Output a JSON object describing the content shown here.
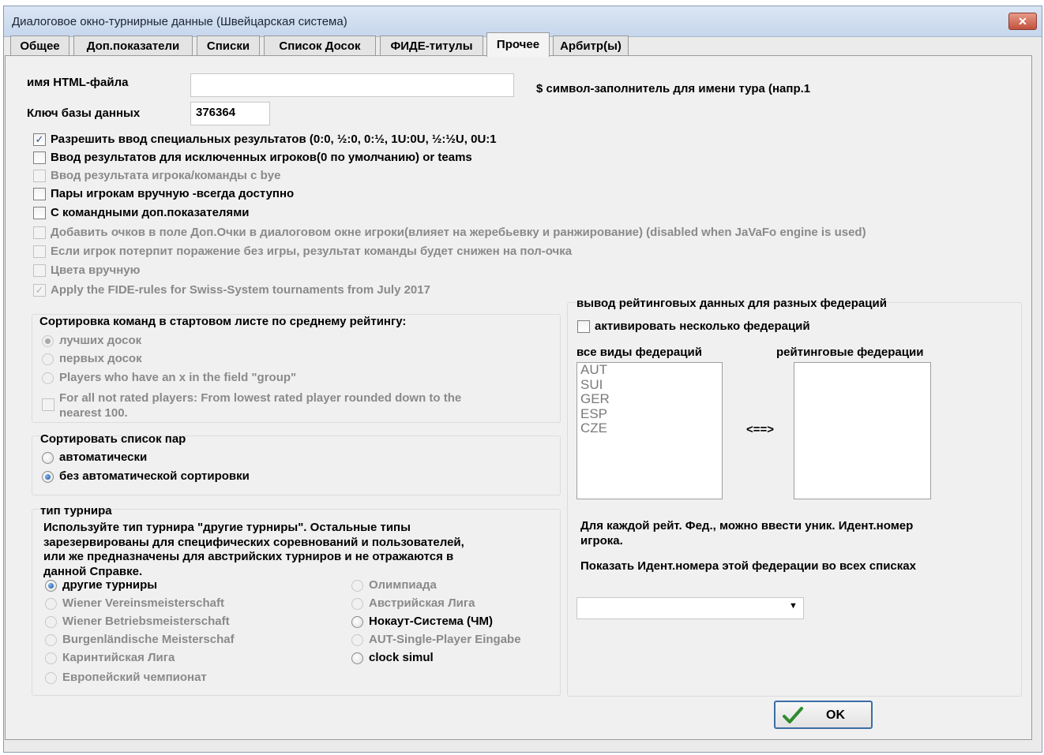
{
  "window": {
    "title": "Диалоговое окно-турнирные данные (Швейцарская система)",
    "close_glyph": "✕"
  },
  "tabs": [
    {
      "label": "Общее"
    },
    {
      "label": "Доп.показатели"
    },
    {
      "label": "Списки"
    },
    {
      "label": "Список Досок"
    },
    {
      "label": "ФИДЕ-титулы"
    },
    {
      "label": "Прочее",
      "active": true
    },
    {
      "label": "Арбитр(ы)"
    }
  ],
  "fields": {
    "html_file_label": "имя HTML-файла",
    "html_file_value": "",
    "html_file_hint": "$ символ-заполнитель для  имени тура (напр.1",
    "db_key_label": "Ключ базы данных",
    "db_key_value": "376364"
  },
  "options": [
    {
      "label": "Разрешить ввод специальных результатов (0:0, ½:0, 0:½, 1U:0U, ½:½U, 0U:1",
      "checked": true,
      "disabled": false
    },
    {
      "label": "Ввод результатов для исключенных игроков(0 по умолчанию) or teams",
      "checked": false,
      "disabled": false
    },
    {
      "label": "Ввод результата игрока/команды с  bye",
      "checked": false,
      "disabled": true
    },
    {
      "label": "Пары игрокам вручную -всегда доступно",
      "checked": false,
      "disabled": false
    },
    {
      "label": "С командными доп.показателями",
      "checked": false,
      "disabled": false
    },
    {
      "label": "Добавить очков в поле Доп.Очки в диалоговом окне игроки(влияет на жеребьевку и ранжирование) (disabled when JaVaFo engine is used)",
      "checked": false,
      "disabled": true
    },
    {
      "label": "Если игрок потерпит поражение без игры,  результат команды будет снижен на пол-очка",
      "checked": false,
      "disabled": true
    },
    {
      "label": "Цвета вручную",
      "checked": false,
      "disabled": true
    },
    {
      "label": "Apply the FIDE-rules for Swiss-System tournaments from July 2017",
      "checked": true,
      "disabled": true
    }
  ],
  "team_sort": {
    "title": "Сортировка команд в стартовом листе  по среднему рейтингу:",
    "radios": [
      {
        "label": "лучших  досок",
        "selected": true
      },
      {
        "label": "первых  досок",
        "selected": false
      },
      {
        "label": "Players who have an x in the field \"group\"",
        "selected": false
      }
    ],
    "checkbox_line1": "For all not rated players: From lowest rated player rounded down to the",
    "checkbox_line2": "nearest 100."
  },
  "pair_sort": {
    "title": "Сортировать список пар",
    "radios": [
      {
        "label": "автоматически",
        "selected": false
      },
      {
        "label": "без автоматической сортировки",
        "selected": true
      }
    ]
  },
  "tournament_type": {
    "title": "тип турнира",
    "desc_lines": [
      "Используйте  тип турнира \"другие турниры\". Остальные типы",
      "зарезервированы для специфических соревнований и пользователей,",
      "или же предназначены для австрийских турниров и не отражаются  в",
      "данной Справке."
    ],
    "left": [
      {
        "label": "другие турниры",
        "selected": true,
        "enabled": true
      },
      {
        "label": "Wiener Vereinsmeisterschaft",
        "selected": false,
        "enabled": false
      },
      {
        "label": "Wiener Betriebsmeisterschaft",
        "selected": false,
        "enabled": false
      },
      {
        "label": "Burgenländische Meisterschaf",
        "selected": false,
        "enabled": false
      },
      {
        "label": "Каринтийская Лига",
        "selected": false,
        "enabled": false
      },
      {
        "label": "Европейский чемпионат",
        "selected": false,
        "enabled": false
      }
    ],
    "right": [
      {
        "label": "Олимпиада",
        "selected": false,
        "enabled": false
      },
      {
        "label": "Австрийская Лига",
        "selected": false,
        "enabled": false
      },
      {
        "label": "Нокаут-Система (ЧМ)",
        "selected": false,
        "enabled": true
      },
      {
        "label": "AUT-Single-Player Eingabe",
        "selected": false,
        "enabled": false
      },
      {
        "label": "clock simul",
        "selected": false,
        "enabled": true
      }
    ]
  },
  "federations": {
    "title": "вывод рейтинговых данных для разных федераций",
    "activate_label": "активировать несколько федераций",
    "activate_checked": false,
    "all_label": "все виды федераций",
    "rating_label": "рейтинговые федерации",
    "all_list": [
      "AUT",
      "SUI",
      "GER",
      "ESP",
      "CZE"
    ],
    "rating_list": [],
    "swap_label": "<==>",
    "info_line1": "Для каждой рейт. Фед., можно  ввести уник. Идент.номер",
    "info_line2": "игрока.",
    "show_ids_label": "Показать Идент.номера этой федерации во всех списках",
    "combo_value": ""
  },
  "ok_label": "OK",
  "colors": {
    "disabled_text": "#8a8a8a",
    "ok_check": "#2e8b2e",
    "dialog_bg": "#f0f0f0"
  }
}
